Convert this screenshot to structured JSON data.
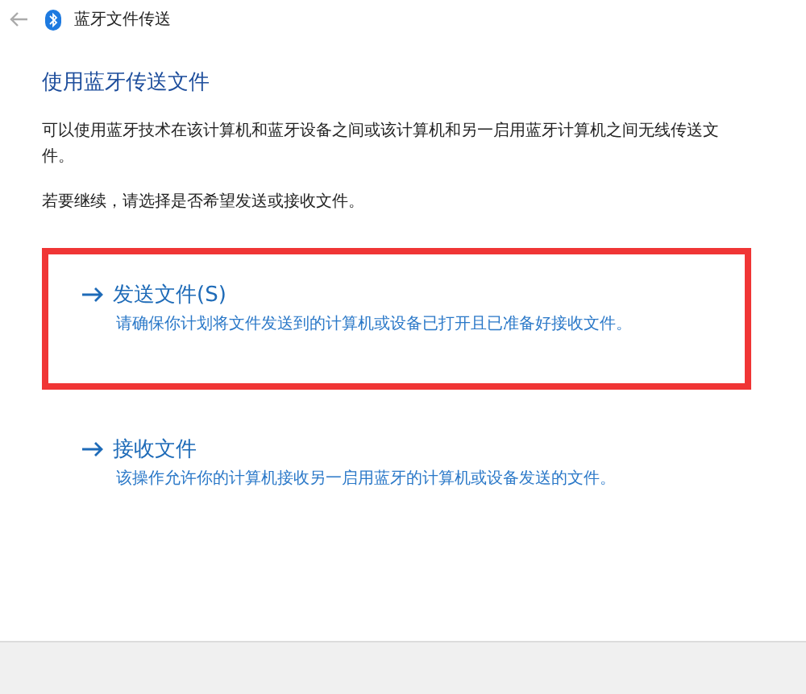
{
  "window": {
    "title": "蓝牙文件传送"
  },
  "heading": "使用蓝牙传送文件",
  "intro": "可以使用蓝牙技术在该计算机和蓝牙设备之间或该计算机和另一启用蓝牙计算机之间无线传送文件。",
  "prompt": "若要继续，请选择是否希望发送或接收文件。",
  "options": [
    {
      "title": "发送文件(S)",
      "description": "请确保你计划将文件发送到的计算机或设备已打开且已准备好接收文件。",
      "highlighted": true
    },
    {
      "title": "接收文件",
      "description": "该操作允许你的计算机接收另一启用蓝牙的计算机或设备发送的文件。",
      "highlighted": false
    }
  ]
}
